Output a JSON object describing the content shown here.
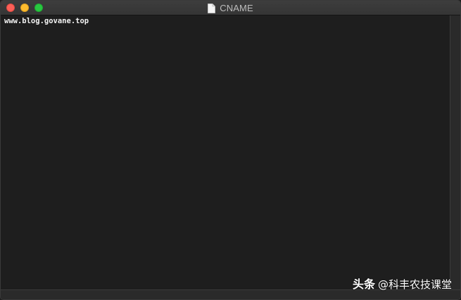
{
  "window": {
    "title": "CNAME",
    "file_icon": "document-icon",
    "traffic_lights": {
      "close_color": "#fc5f57",
      "minimize_color": "#fdbc2e",
      "zoom_color": "#28c840"
    }
  },
  "editor": {
    "lines": [
      "www.blog.govane.top"
    ]
  },
  "watermark": {
    "brand": "头条",
    "account": "@科丰农技课堂"
  }
}
